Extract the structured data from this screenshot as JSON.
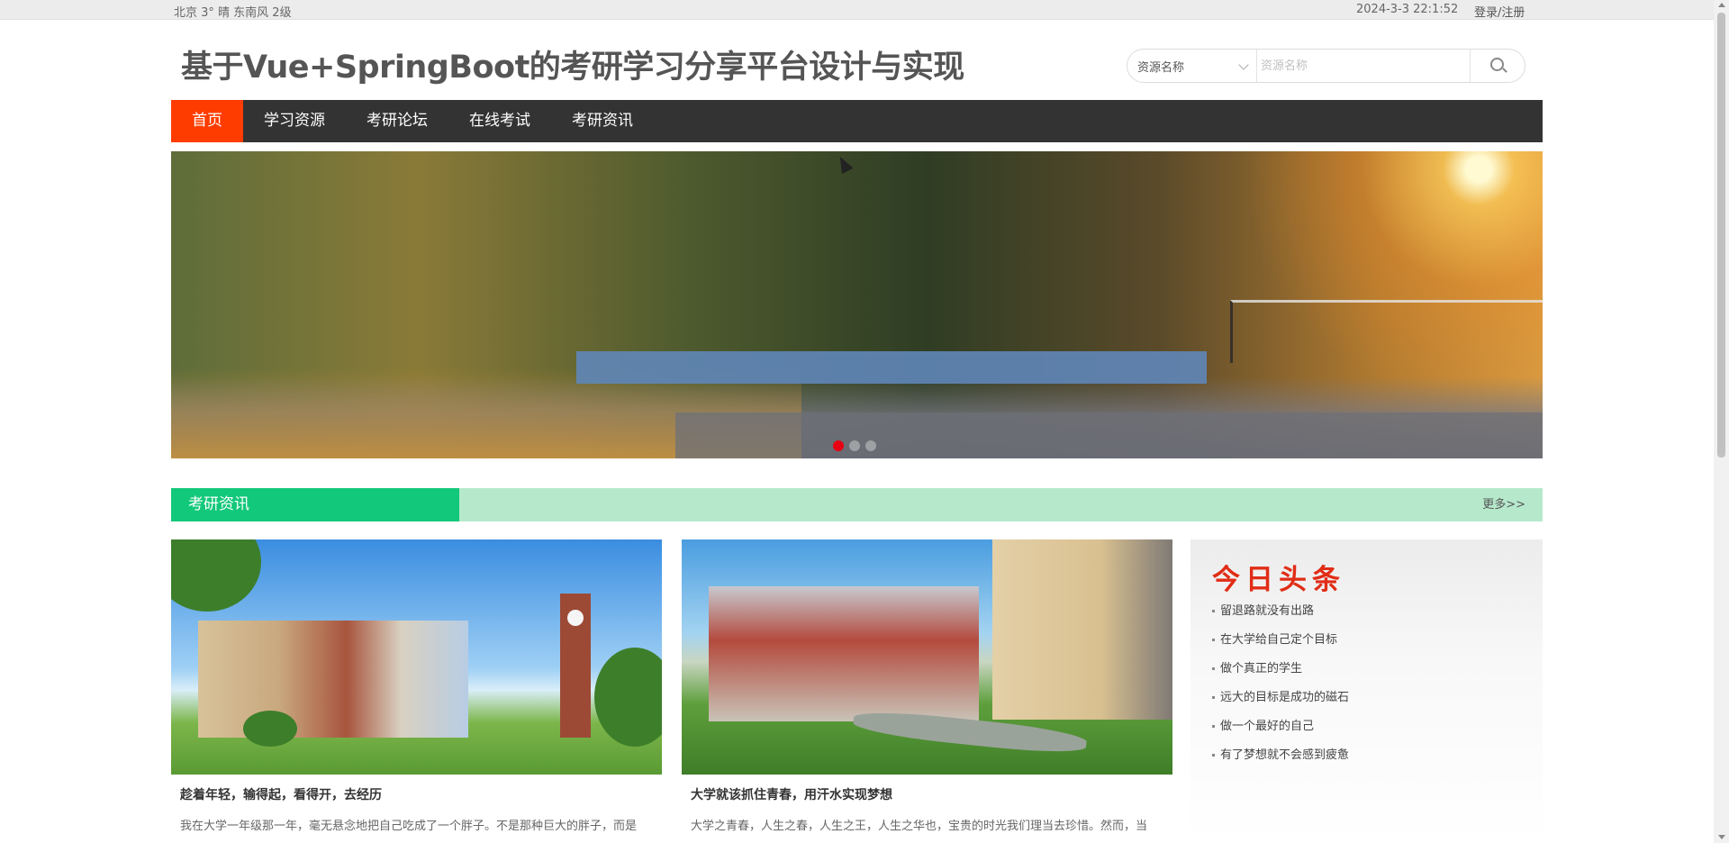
{
  "topbar": {
    "weather": "北京  3°  晴  东南风  2级",
    "datetime": "2024-3-3 22:1:52",
    "login_label": "登录/注册"
  },
  "header": {
    "title": "基于Vue+SpringBoot的考研学习分享平台设计与实现"
  },
  "search": {
    "select_value": "资源名称",
    "placeholder": "资源名称",
    "icon": "search-icon"
  },
  "nav": {
    "items": [
      {
        "label": "首页",
        "active": true
      },
      {
        "label": "学习资源",
        "active": false
      },
      {
        "label": "考研论坛",
        "active": false
      },
      {
        "label": "在线考试",
        "active": false
      },
      {
        "label": "考研资讯",
        "active": false
      }
    ],
    "active_color": "#ff3c00",
    "bar_color": "#333333"
  },
  "banner": {
    "slide_count": 3,
    "active_slide": 1,
    "indicator_active_color": "#e60012"
  },
  "section": {
    "title": "考研资讯",
    "more_label": "更多>>",
    "accent_color": "#12c87a"
  },
  "cards": [
    {
      "title": "趁着年轻，输得起，看得开，去经历",
      "excerpt": "我在大学一年级那一年，毫无悬念地把自己吃成了一个胖子。不是那种巨大的胖子，而是"
    },
    {
      "title": "大学就该抓住青春，用汗水实现梦想",
      "excerpt": "大学之青春，人生之春，人生之王，人生之华也，宝贵的时光我们理当去珍惜。然而，当"
    }
  ],
  "news": {
    "heading": "今日头条",
    "items": [
      "留退路就没有出路",
      "在大学给自己定个目标",
      "做个真正的学生",
      "远大的目标是成功的磁石",
      "做一个最好的自己",
      "有了梦想就不会感到疲惫"
    ],
    "heading_color": "#e12d16"
  }
}
